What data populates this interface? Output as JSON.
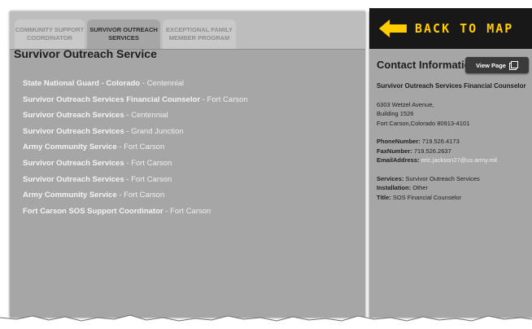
{
  "tabs": [
    {
      "line1": "COMMUNITY SUPPORT",
      "line2": "COORDINATOR"
    },
    {
      "line1": "SURVIVOR OUTREACH",
      "line2": "SERVICES"
    },
    {
      "line1": "EXCEPTIONAL FAMILY",
      "line2": "MEMBER PROGRAM"
    }
  ],
  "panel_title": "Survivor Outreach Service",
  "results": [
    {
      "name": "State National Guard - Colorado",
      "location": "Centennial"
    },
    {
      "name": "Survivor Outreach Services Financial Counselor",
      "location": "Fort Carson"
    },
    {
      "name": "Survivor Outreach Services",
      "location": "Centennial"
    },
    {
      "name": "Survivor Outreach Services",
      "location": "Grand Junction"
    },
    {
      "name": "Army Community Service",
      "location": "Fort Carson"
    },
    {
      "name": "Survivor Outreach Services",
      "location": "Fort Carson"
    },
    {
      "name": "Survivor Outreach Services",
      "location": "Fort Carson"
    },
    {
      "name": "Army Community Service",
      "location": "Fort Carson"
    },
    {
      "name": "Fort Carson SOS Support Coordinator",
      "location": "Fort Carson"
    }
  ],
  "separator": "-",
  "back_to_map": "BACK TO MAP",
  "contact": {
    "title": "Contact Information",
    "view_page": "View Page",
    "org": "Survivor Outreach Services Financial Counselor",
    "address1": "6303 Wetzel Avenue,",
    "address2": "Building 1526",
    "address3": "Fort Carson,Colorado  80913-4101",
    "phone_label": "PhoneNumber:",
    "phone": "719.526.4173",
    "fax_label": "FaxNumber:",
    "fax": "719.526.2637",
    "email_label": "EmailAddress:",
    "email": "eric.jackson27@us.army.mil",
    "services_label": "Services:",
    "services": "Survivor Outreach Services",
    "installation_label": "Installation:",
    "installation": "Other",
    "title_label": "Title:",
    "title_value": "SOS Financial Counselor"
  },
  "colors": {
    "back_arrow": "#ffcc00",
    "panel": "#a6a6a6",
    "header_bar": "#181818"
  }
}
